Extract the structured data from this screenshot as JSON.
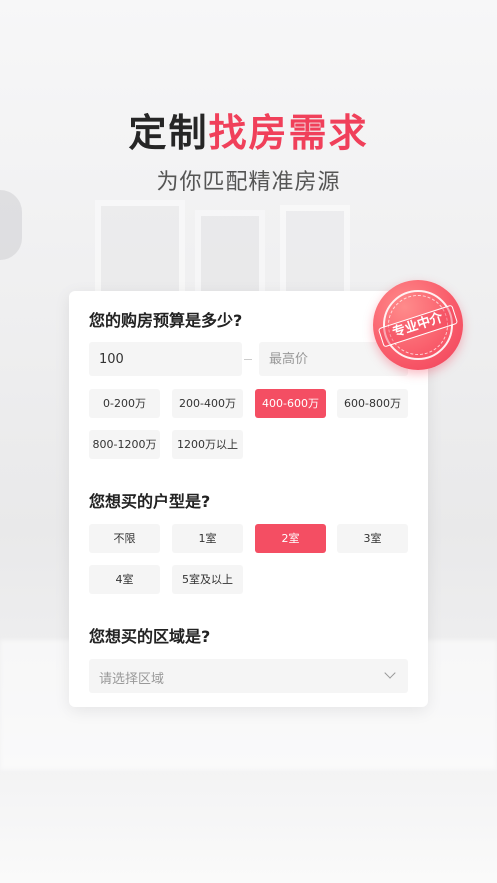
{
  "header": {
    "title_part1": "定制",
    "title_part2": "找房需求",
    "subtitle": "为你匹配精准房源"
  },
  "badge": {
    "text": "专业中介"
  },
  "budget": {
    "question": "您的购房预算是多少?",
    "min_value": "100",
    "max_placeholder": "最高价",
    "options": [
      "0-200万",
      "200-400万",
      "400-600万",
      "600-800万",
      "800-1200万",
      "1200万以上"
    ],
    "selected": "400-600万"
  },
  "layout": {
    "question": "您想买的户型是?",
    "options": [
      "不限",
      "1室",
      "2室",
      "3室",
      "4室",
      "5室及以上"
    ],
    "selected": "2室"
  },
  "area": {
    "question": "您想买的区域是?",
    "placeholder": "请选择区域"
  },
  "colors": {
    "accent": "#f44e63",
    "title_dark": "#262626"
  }
}
